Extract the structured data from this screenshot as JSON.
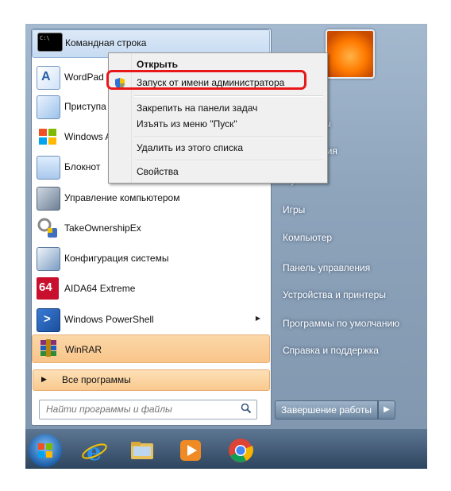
{
  "programs": [
    {
      "label": "Командная строка",
      "icon": "cmd-icon"
    },
    {
      "label": "WordPad",
      "icon": "wordpad-icon"
    },
    {
      "label": "Приступа",
      "icon": "getting-started-icon"
    },
    {
      "label": "Windows A",
      "icon": "windows-flag-icon"
    },
    {
      "label": "Блокнот",
      "icon": "notepad-icon"
    },
    {
      "label": "Управление компьютером",
      "icon": "computer-management-icon"
    },
    {
      "label": "TakeOwnershipEx",
      "icon": "takeownership-icon"
    },
    {
      "label": "Конфигурация системы",
      "icon": "msconfig-icon"
    },
    {
      "label": "AIDA64 Extreme",
      "icon": "aida64-icon"
    },
    {
      "label": "Windows PowerShell",
      "icon": "powershell-icon"
    },
    {
      "label": "WinRAR",
      "icon": "winrar-icon"
    }
  ],
  "all_programs": "Все программы",
  "search_placeholder": "Найти программы и файлы",
  "context_menu": {
    "open": "Открыть",
    "run_as_admin": "Запуск от имени администратора",
    "pin_taskbar": "Закрепить на панели задач",
    "unpin_start": "Изъять из меню \"Пуск\"",
    "remove_list": "Удалить из этого списка",
    "properties": "Свойства"
  },
  "right_pane": {
    "partial1": "ы",
    "partial2": "ния",
    "partial3": "у",
    "games": "Игры",
    "computer": "Компьютер",
    "control_panel": "Панель управления",
    "devices": "Устройства и принтеры",
    "default_programs": "Программы по умолчанию",
    "help": "Справка и поддержка"
  },
  "shutdown": "Завершение работы",
  "colors": {
    "highlight_ring": "#e8171a",
    "accent_orange": "#f9c58a"
  },
  "taskbar_icons": [
    "start-orb-icon",
    "internet-explorer-icon",
    "explorer-folder-icon",
    "media-player-icon",
    "chrome-icon"
  ]
}
